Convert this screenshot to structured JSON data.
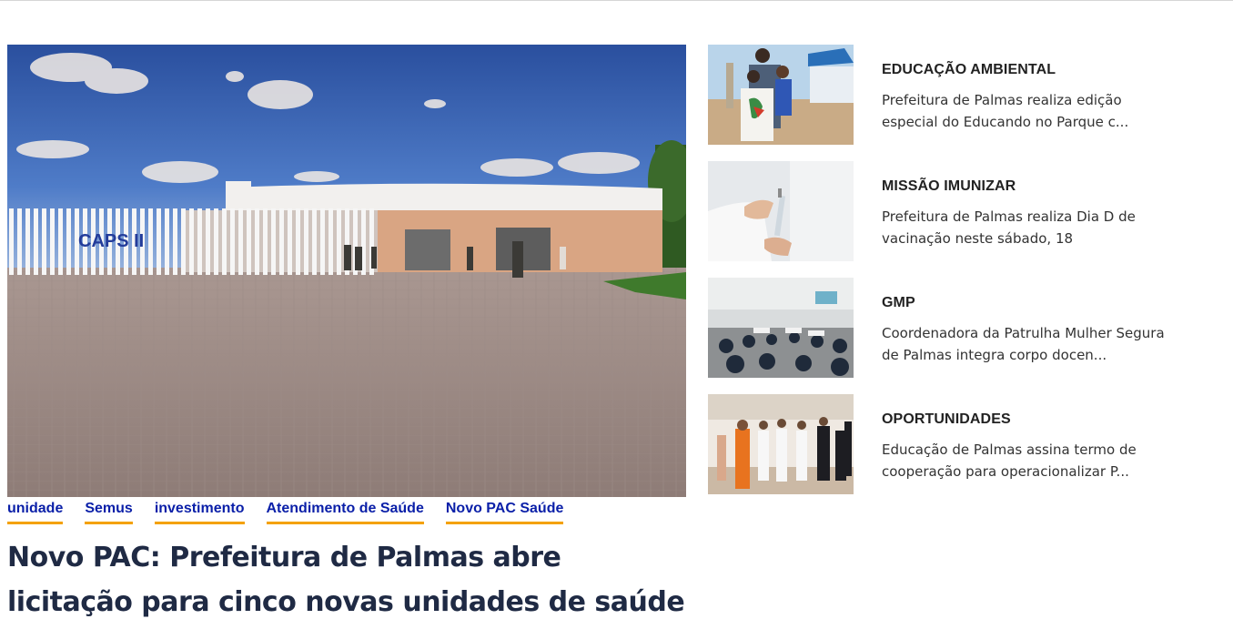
{
  "featured": {
    "image_alt": "CAPS II",
    "image_sign": "CAPS II",
    "tags": [
      {
        "label": "unidade"
      },
      {
        "label": "Semus"
      },
      {
        "label": "investimento"
      },
      {
        "label": "Atendimento de Saúde"
      },
      {
        "label": "Novo PAC Saúde"
      }
    ],
    "headline": "Novo PAC: Prefeitura de Palmas abre licitação para cinco novas unidades de saúde"
  },
  "side_news": [
    {
      "category": "EDUCAÇÃO AMBIENTAL",
      "summary": "Prefeitura de Palmas realiza edição especial do Educando no Parque c..."
    },
    {
      "category": "MISSÃO IMUNIZAR",
      "summary": "Prefeitura de Palmas realiza Dia D de vacinação neste sábado, 18"
    },
    {
      "category": "GMP",
      "summary": "Coordenadora da Patrulha Mulher Segura de Palmas integra corpo docen..."
    },
    {
      "category": "OPORTUNIDADES",
      "summary": "Educação de Palmas assina termo de cooperação para operacionalizar P..."
    }
  ],
  "colors": {
    "tag_text": "#0a1fa8",
    "tag_underline": "#f4a100",
    "headline": "#1f2a44"
  }
}
